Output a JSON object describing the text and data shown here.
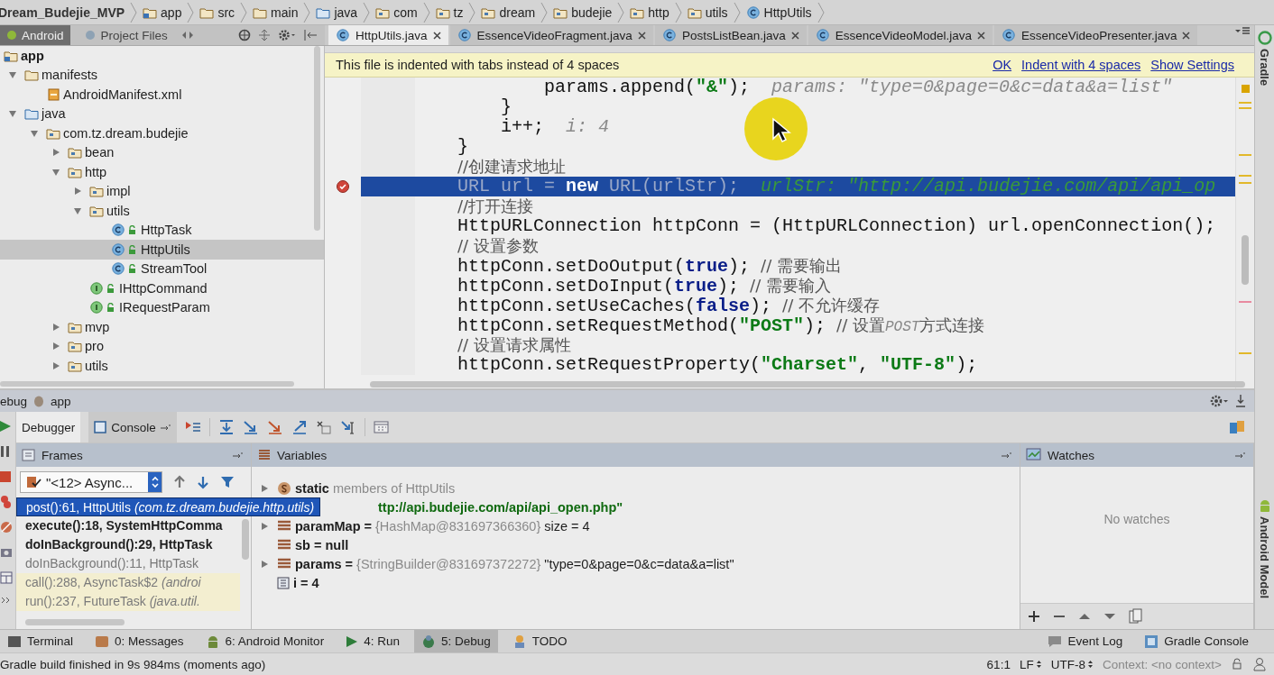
{
  "breadcrumbs": [
    {
      "label": "Dream_Budejie_MVP",
      "kind": "none"
    },
    {
      "label": "app",
      "kind": "module"
    },
    {
      "label": "src",
      "kind": "folder"
    },
    {
      "label": "main",
      "kind": "folder"
    },
    {
      "label": "java",
      "kind": "source"
    },
    {
      "label": "com",
      "kind": "package"
    },
    {
      "label": "tz",
      "kind": "package"
    },
    {
      "label": "dream",
      "kind": "package"
    },
    {
      "label": "budejie",
      "kind": "package"
    },
    {
      "label": "http",
      "kind": "package"
    },
    {
      "label": "utils",
      "kind": "package"
    },
    {
      "label": "HttpUtils",
      "kind": "class"
    }
  ],
  "project_panel": {
    "tabs": [
      {
        "label": "Android",
        "selected": true
      },
      {
        "label": "Project Files",
        "selected": false
      }
    ],
    "tree": [
      {
        "label": "app",
        "kind": "module",
        "selected": false,
        "children": [
          {
            "label": "manifests",
            "kind": "folder",
            "expanded": true,
            "selected": false,
            "children": [
              {
                "label": "AndroidManifest.xml",
                "kind": "manifest",
                "selected": false
              }
            ]
          },
          {
            "label": "java",
            "kind": "source",
            "expanded": true,
            "selected": false,
            "children": [
              {
                "label": "com.tz.dream.budejie",
                "kind": "package",
                "expanded": true,
                "selected": false,
                "children": [
                  {
                    "label": "bean",
                    "kind": "package",
                    "expanded": false,
                    "selected": false
                  },
                  {
                    "label": "http",
                    "kind": "package",
                    "expanded": true,
                    "selected": false,
                    "children": [
                      {
                        "label": "impl",
                        "kind": "package",
                        "expanded": false,
                        "selected": false
                      },
                      {
                        "label": "utils",
                        "kind": "package",
                        "expanded": true,
                        "selected": false,
                        "children": [
                          {
                            "label": "HttpTask",
                            "kind": "class",
                            "selected": false
                          },
                          {
                            "label": "HttpUtils",
                            "kind": "class",
                            "selected": true
                          },
                          {
                            "label": "StreamTool",
                            "kind": "class",
                            "selected": false
                          }
                        ]
                      },
                      {
                        "label": "IHttpCommand",
                        "kind": "interface",
                        "selected": false
                      },
                      {
                        "label": "IRequestParam",
                        "kind": "interface",
                        "selected": false
                      }
                    ]
                  },
                  {
                    "label": "mvp",
                    "kind": "package",
                    "expanded": false,
                    "selected": false
                  },
                  {
                    "label": "pro",
                    "kind": "package",
                    "expanded": false,
                    "selected": false
                  },
                  {
                    "label": "utils",
                    "kind": "package",
                    "expanded": false,
                    "selected": false
                  }
                ]
              }
            ]
          }
        ]
      }
    ]
  },
  "editor": {
    "tabs": [
      {
        "label": "HttpUtils.java",
        "selected": true
      },
      {
        "label": "EssenceVideoFragment.java",
        "selected": false
      },
      {
        "label": "PostsListBean.java",
        "selected": false
      },
      {
        "label": "EssenceVideoModel.java",
        "selected": false
      },
      {
        "label": "EssenceVideoPresenter.java",
        "selected": false
      }
    ],
    "notification": {
      "message": "This file is indented with tabs instead of 4 spaces",
      "actions": [
        "OK",
        "Indent with 4 spaces",
        "Show Settings"
      ]
    },
    "lines": [
      {
        "breakpoint": false,
        "current": false,
        "tokens": [
          {
            "t": "        params.append(",
            "kind": "plain"
          },
          {
            "t": "\"&\"",
            "kind": "str"
          },
          {
            "t": ");",
            "kind": "plain"
          },
          {
            "t": "  params: \"type=0&page=0&c=data&a=list\"",
            "kind": "hint"
          }
        ]
      },
      {
        "breakpoint": false,
        "current": false,
        "tokens": [
          {
            "t": "    }",
            "kind": "plain"
          }
        ]
      },
      {
        "breakpoint": false,
        "current": false,
        "tokens": [
          {
            "t": "    i++;",
            "kind": "plain"
          },
          {
            "t": "  i: 4",
            "kind": "hint"
          }
        ]
      },
      {
        "breakpoint": false,
        "current": false,
        "tokens": [
          {
            "t": "}",
            "kind": "plain"
          }
        ]
      },
      {
        "breakpoint": false,
        "current": false,
        "tokens": [
          {
            "t": "//创建请求地址",
            "kind": "cm"
          }
        ]
      },
      {
        "breakpoint": true,
        "current": true,
        "tokens": [
          {
            "t": "URL url = ",
            "kind": "plain"
          },
          {
            "t": "new",
            "kind": "kw"
          },
          {
            "t": " URL(urlStr);",
            "kind": "plain"
          },
          {
            "t": "  urlStr: \"http://api.budejie.com/api/api_op",
            "kind": "hint"
          }
        ]
      },
      {
        "breakpoint": false,
        "current": false,
        "tokens": [
          {
            "t": "//打开连接",
            "kind": "cm"
          }
        ]
      },
      {
        "breakpoint": false,
        "current": false,
        "tokens": [
          {
            "t": "HttpURLConnection httpConn = (HttpURLConnection) url.openConnection();",
            "kind": "plain"
          }
        ]
      },
      {
        "breakpoint": false,
        "current": false,
        "tokens": [
          {
            "t": "// 设置参数",
            "kind": "cm"
          }
        ]
      },
      {
        "breakpoint": false,
        "current": false,
        "tokens": [
          {
            "t": "httpConn.setDoOutput(",
            "kind": "plain"
          },
          {
            "t": "true",
            "kind": "kw"
          },
          {
            "t": "); ",
            "kind": "plain"
          },
          {
            "t": "// 需要输出",
            "kind": "cm"
          }
        ]
      },
      {
        "breakpoint": false,
        "current": false,
        "tokens": [
          {
            "t": "httpConn.setDoInput(",
            "kind": "plain"
          },
          {
            "t": "true",
            "kind": "kw"
          },
          {
            "t": "); ",
            "kind": "plain"
          },
          {
            "t": "// 需要输入",
            "kind": "cm"
          }
        ]
      },
      {
        "breakpoint": false,
        "current": false,
        "tokens": [
          {
            "t": "httpConn.setUseCaches(",
            "kind": "plain"
          },
          {
            "t": "false",
            "kind": "kw"
          },
          {
            "t": "); ",
            "kind": "plain"
          },
          {
            "t": "// 不允许缓存",
            "kind": "cm"
          }
        ]
      },
      {
        "breakpoint": false,
        "current": false,
        "tokens": [
          {
            "t": "httpConn.setRequestMethod(",
            "kind": "plain"
          },
          {
            "t": "\"POST\"",
            "kind": "str"
          },
          {
            "t": "); ",
            "kind": "plain"
          },
          {
            "t": "// 设置",
            "kind": "cm"
          },
          {
            "t": "POST",
            "kind": "cmi"
          },
          {
            "t": "方式连接",
            "kind": "cm"
          }
        ]
      },
      {
        "breakpoint": false,
        "current": false,
        "tokens": [
          {
            "t": "// 设置请求属性",
            "kind": "cm"
          }
        ]
      },
      {
        "breakpoint": false,
        "current": false,
        "tokens": [
          {
            "t": "httpConn.setRequestProperty(",
            "kind": "plain"
          },
          {
            "t": "\"Charset\"",
            "kind": "str"
          },
          {
            "t": ", ",
            "kind": "plain"
          },
          {
            "t": "\"UTF-8\"",
            "kind": "str"
          },
          {
            "t": ");",
            "kind": "plain"
          }
        ]
      }
    ]
  },
  "debug": {
    "title": "ebug",
    "config": "app",
    "tabs": [
      {
        "label": "Debugger",
        "selected": true
      },
      {
        "label": "Console",
        "selected": false
      }
    ],
    "frames": {
      "title": "Frames",
      "thread": "\"<12> Async...",
      "items": [
        {
          "method": "post():61, HttpUtils",
          "package": "(com.tz.dream.budejie.http.utils)",
          "kind": "app",
          "selected": true
        },
        {
          "method": "execute():18, SystemHttpComma",
          "kind": "app",
          "selected": false
        },
        {
          "method": "doInBackground():29, HttpTask",
          "kind": "app",
          "selected": false
        },
        {
          "method": "doInBackground():11, HttpTask",
          "kind": "sdk",
          "selected": false
        },
        {
          "method": "call():288, AsyncTask$2",
          "package": "(androi",
          "kind": "library",
          "selected": false
        },
        {
          "method": "run():237, FutureTask",
          "package": "(java.util.",
          "kind": "library",
          "selected": false
        }
      ]
    },
    "variables": {
      "title": "Variables",
      "items": [
        {
          "kind": "static",
          "expanded": false,
          "name": "static",
          "ref": "members of HttpUtils"
        },
        {
          "kind": "string",
          "value": "ttp://api.budejie.com/api/api_open.php\""
        },
        {
          "kind": "field",
          "expanded": false,
          "name": "paramMap =",
          "ref": "{HashMap@831697366360}",
          "value": "size = 4"
        },
        {
          "kind": "field",
          "name": "sb = null"
        },
        {
          "kind": "field",
          "expanded": false,
          "name": "params =",
          "ref": "{StringBuilder@831697372272}",
          "value": "\"type=0&page=0&c=data&a=list\""
        },
        {
          "kind": "primitive",
          "name": "i = 4"
        }
      ]
    },
    "watches": {
      "title": "Watches",
      "empty": "No watches"
    }
  },
  "side_tabs": [
    {
      "label": "Gradle",
      "kind": "gradle"
    },
    {
      "label": "Android Model",
      "kind": "android"
    }
  ],
  "tool_windows": [
    {
      "label": "Terminal",
      "kind": "terminal",
      "selected": false
    },
    {
      "label": "0: Messages",
      "kind": "messages",
      "selected": false
    },
    {
      "label": "6: Android Monitor",
      "kind": "android",
      "selected": false
    },
    {
      "label": "4: Run",
      "kind": "run",
      "selected": false
    },
    {
      "label": "5: Debug",
      "kind": "debug",
      "selected": true
    },
    {
      "label": "TODO",
      "kind": "todo",
      "selected": false
    }
  ],
  "tool_windows_right": [
    {
      "label": "Event Log",
      "kind": "log"
    },
    {
      "label": "Gradle Console",
      "kind": "console"
    }
  ],
  "status_bar": {
    "message": "Gradle build finished in 9s 984ms (moments ago)",
    "position": "61:1",
    "line_separator": "LF",
    "encoding": "UTF-8",
    "context": "Context: <no context>"
  }
}
